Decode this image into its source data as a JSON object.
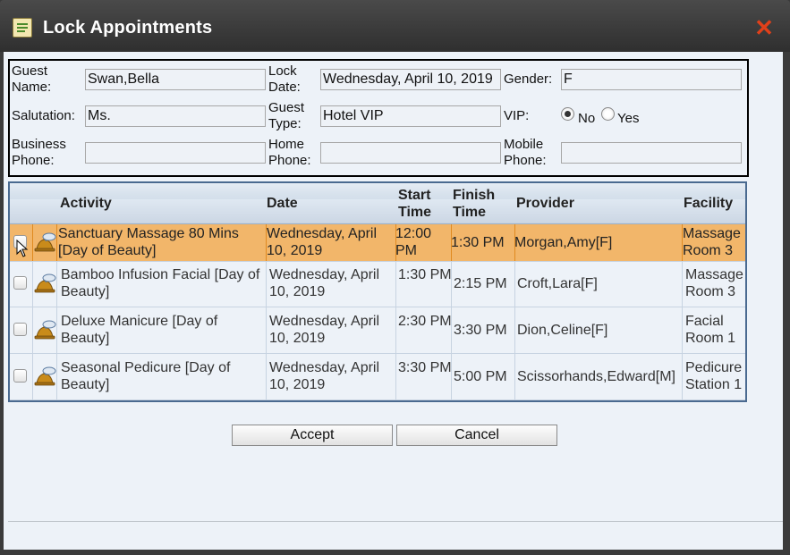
{
  "window": {
    "title": "Lock Appointments",
    "close_glyph": "✕"
  },
  "guest": {
    "guest_name_label": "Guest Name:",
    "guest_name": "Swan,Bella",
    "lock_date_label": "Lock Date:",
    "lock_date": "Wednesday, April 10, 2019",
    "gender_label": "Gender:",
    "gender": "F",
    "salutation_label": "Salutation:",
    "salutation": "Ms.",
    "guest_type_label": "Guest Type:",
    "guest_type": "Hotel VIP",
    "vip_label": "VIP:",
    "vip_no": "No",
    "vip_yes": "Yes",
    "vip_selected": "No",
    "business_phone_label": "Business Phone:",
    "business_phone": "",
    "home_phone_label": "Home Phone:",
    "home_phone": "",
    "mobile_phone_label": "Mobile Phone:",
    "mobile_phone": ""
  },
  "table": {
    "headers": {
      "activity": "Activity",
      "date": "Date",
      "start": "Start Time",
      "finish": "Finish Time",
      "provider": "Provider",
      "facility": "Facility"
    },
    "rows": [
      {
        "activity": "Sanctuary Massage 80 Mins [Day of Beauty]",
        "date": "Wednesday, April 10, 2019",
        "start": "12:00 PM",
        "finish": "1:30 PM",
        "provider": "Morgan,Amy[F]",
        "facility": "Massage Room 3",
        "selected": true
      },
      {
        "activity": "Bamboo Infusion Facial [Day of Beauty]",
        "date": "Wednesday, April 10, 2019",
        "start": "1:30 PM",
        "finish": "2:15 PM",
        "provider": "Croft,Lara[F]",
        "facility": "Massage Room 3",
        "selected": false
      },
      {
        "activity": "Deluxe Manicure [Day of Beauty]",
        "date": "Wednesday, April 10, 2019",
        "start": "2:30 PM",
        "finish": "3:30 PM",
        "provider": "Dion,Celine[F]",
        "facility": "Facial Room 1",
        "selected": false
      },
      {
        "activity": "Seasonal Pedicure [Day of Beauty]",
        "date": "Wednesday, April 10, 2019",
        "start": "3:30 PM",
        "finish": "5:00 PM",
        "provider": "Scissorhands,Edward[M]",
        "facility": "Pedicure Station 1",
        "selected": false
      }
    ]
  },
  "buttons": {
    "accept": "Accept",
    "cancel": "Cancel"
  },
  "colors": {
    "selected_row": "#f2b66a",
    "close": "#e0401a",
    "grid_border": "#4a6a90"
  }
}
